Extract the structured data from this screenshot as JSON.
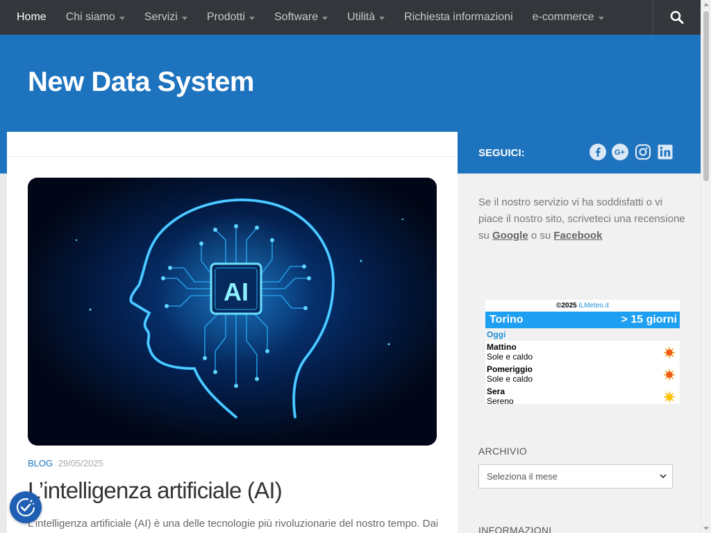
{
  "nav": {
    "items": [
      {
        "label": "Home",
        "active": true,
        "dropdown": false
      },
      {
        "label": "Chi siamo",
        "active": false,
        "dropdown": true
      },
      {
        "label": "Servizi",
        "active": false,
        "dropdown": true
      },
      {
        "label": "Prodotti",
        "active": false,
        "dropdown": true
      },
      {
        "label": "Software",
        "active": false,
        "dropdown": true
      },
      {
        "label": "Utilità",
        "active": false,
        "dropdown": true
      },
      {
        "label": "Richiesta informazioni",
        "active": false,
        "dropdown": false
      },
      {
        "label": "e-commerce",
        "active": false,
        "dropdown": true
      }
    ],
    "search_icon": "search-icon"
  },
  "header": {
    "site_title": "New Data System"
  },
  "post": {
    "hero_text": "AI",
    "category": "BLOG",
    "date": "29/05/2025",
    "title": "L’intelligenza artificiale (AI)",
    "excerpt": "L’intelligenza artificiale (AI) è una delle tecnologie più rivoluzionarie del nostro tempo. Dai"
  },
  "sidebar": {
    "follow_label": "SEGUICI:",
    "social_icons": [
      "facebook-icon",
      "google-plus-icon",
      "instagram-icon",
      "linkedin-icon"
    ],
    "review_text_1": "Se il nostro servizio vi ha soddisfatti o vi piace il nostro sito, scriveteci una recensione su",
    "review_link_google": "Google",
    "review_text_2": "o su",
    "review_link_facebook": "Facebook",
    "meteo": {
      "copyright": "©2025",
      "brand": "iLMeteo.it",
      "city": "Torino",
      "forecast_link": "> 15 giorni",
      "today": "Oggi",
      "rows": [
        {
          "period": "Mattino",
          "condition": "Sole e caldo",
          "icon": "sun-hot-icon"
        },
        {
          "period": "Pomeriggio",
          "condition": "Sole e caldo",
          "icon": "sun-hot-icon"
        },
        {
          "period": "Sera",
          "condition": "Sereno",
          "icon": "sun-icon"
        }
      ]
    },
    "archive_heading": "ARCHIVIO",
    "archive_select": "Seleziona il mese",
    "info_heading": "INFORMAZIONI"
  },
  "colors": {
    "nav_bg": "#33363b",
    "brand_blue": "#1e73be",
    "meteo_blue": "#1e9ff2"
  }
}
